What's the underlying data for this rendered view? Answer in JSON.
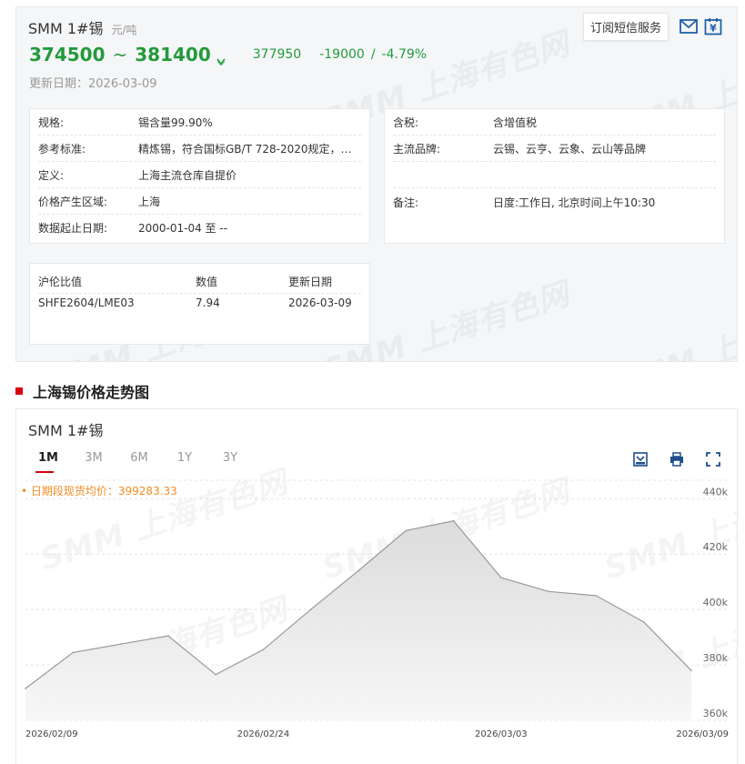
{
  "header": {
    "title": "SMM 1#锡",
    "unit": "元/吨",
    "subscribe_label": "订阅短信服务",
    "price_low": "374500",
    "price_sep": "~",
    "price_high": "381400",
    "avg_price": "377950",
    "change": "-19000",
    "change_pct": "-4.79%",
    "update_label": "更新日期：",
    "update_date": "2026-03-09",
    "price_color": "#239a3b"
  },
  "spec_left": [
    {
      "label": "规格:",
      "value": "锡含量99.90%"
    },
    {
      "label": "参考标准:",
      "value": "精炼锡，符合国标GB/T 728-2020规定，锡..."
    },
    {
      "label": "定义:",
      "value": "上海主流仓库自提价"
    },
    {
      "label": "价格产生区域:",
      "value": "上海"
    },
    {
      "label": "数据起止日期:",
      "value": "2000-01-04 至 --"
    }
  ],
  "spec_right": [
    {
      "label": "含税:",
      "value": "含增值税"
    },
    {
      "label": "主流品牌:",
      "value": "云锡、云亨、云象、云山等品牌"
    },
    {
      "label": "备注:",
      "value": "日度:工作日, 北京时间上午10:30"
    }
  ],
  "ratio": {
    "headers": [
      "沪伦比值",
      "数值",
      "更新日期"
    ],
    "row": [
      "SHFE2604/LME03",
      "7.94",
      "2026-03-09"
    ]
  },
  "section_title": "上海锡价格走势图",
  "chart_panel": {
    "title": "SMM 1#锡",
    "tabs": [
      "1M",
      "3M",
      "6M",
      "1Y",
      "3Y"
    ],
    "active_tab": "1M",
    "avg_note": "• 日期段现货均价：399283.33",
    "tools": [
      "download-icon",
      "print-icon",
      "fullscreen-icon"
    ]
  },
  "watermark_text": "SMM 上海有色网",
  "chart_data": {
    "type": "area",
    "x": [
      "2026-02-09",
      "2026-02-11",
      "2026-02-13",
      "2026-02-24",
      "2026-02-25",
      "2026-02-26",
      "2026-02-27",
      "2026-03-02",
      "2026-03-03",
      "2026-03-04",
      "2026-03-05",
      "2026-03-06",
      "2026-03-09"
    ],
    "values": [
      371500,
      384500,
      387500,
      390500,
      376500,
      385500,
      400000,
      414000,
      428500,
      432000,
      411500,
      406500,
      405000,
      395500,
      377950
    ],
    "x_all": [
      "2026-02-09",
      "2026-02-10",
      "2026-02-11",
      "2026-02-12",
      "2026-02-13",
      "2026-02-24",
      "2026-02-25",
      "2026-02-26",
      "2026-02-27",
      "2026-03-02",
      "2026-03-03",
      "2026-03-04",
      "2026-03-05",
      "2026-03-06",
      "2026-03-09"
    ],
    "xticks": [
      "2026/02/09",
      "2026/02/24",
      "2026/03/03",
      "2026/03/09"
    ],
    "yticks": [
      "360k",
      "380k",
      "400k",
      "420k",
      "440k"
    ],
    "ylim": [
      360000,
      446000
    ],
    "grid": true,
    "line_color": "#999999",
    "fill_color": "#e8e8e8"
  }
}
